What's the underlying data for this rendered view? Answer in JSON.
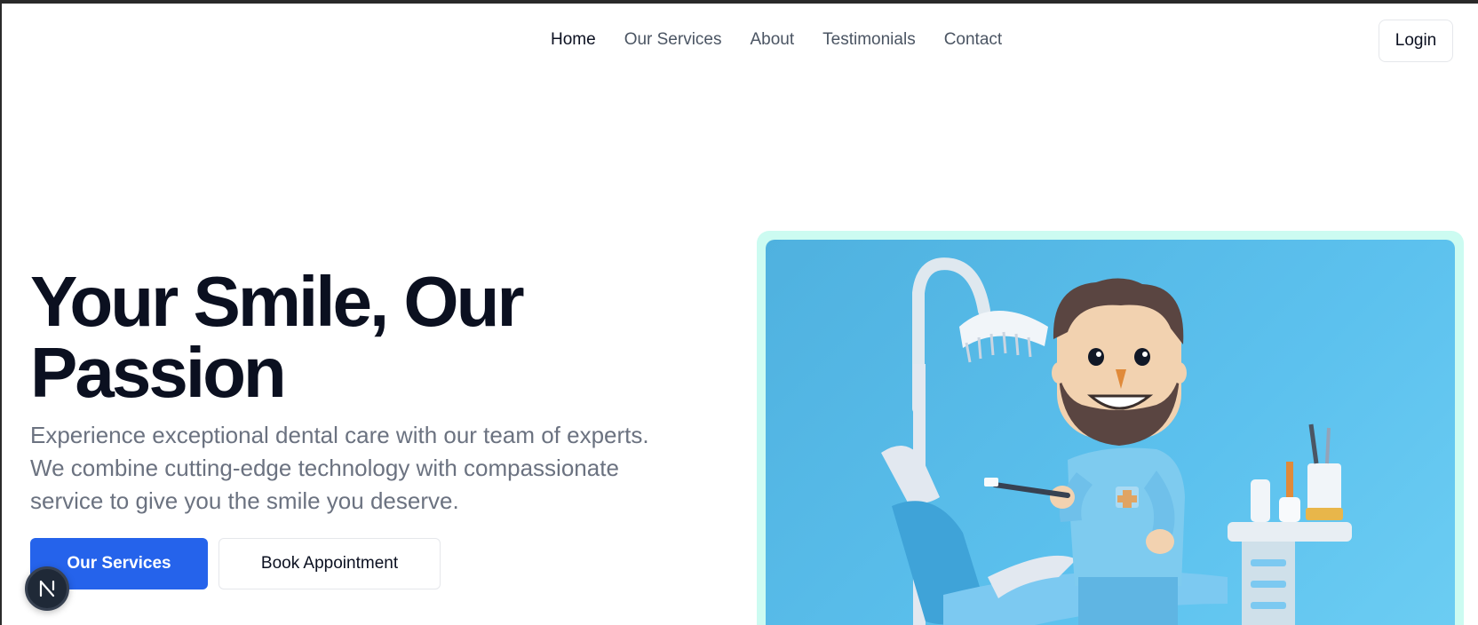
{
  "nav": {
    "links": [
      {
        "label": "Home",
        "active": true
      },
      {
        "label": "Our Services",
        "active": false
      },
      {
        "label": "About",
        "active": false
      },
      {
        "label": "Testimonials",
        "active": false
      },
      {
        "label": "Contact",
        "active": false
      }
    ],
    "login_label": "Login"
  },
  "hero": {
    "title_line1": "Your Smile, Our",
    "title_line2": "Passion",
    "description": "Experience exceptional dental care with our team of experts. We combine cutting-edge technology with compassionate service to give you the smile you deserve.",
    "primary_button": "Our Services",
    "secondary_button": "Book Appointment",
    "image_icon": "dentist-illustration"
  },
  "colors": {
    "accent": "#2563eb",
    "image_frame": "#ccfbf1",
    "image_background": "#5cc1ee"
  },
  "dev_badge": {
    "icon": "nextjs-logo-icon",
    "letter": "N"
  }
}
